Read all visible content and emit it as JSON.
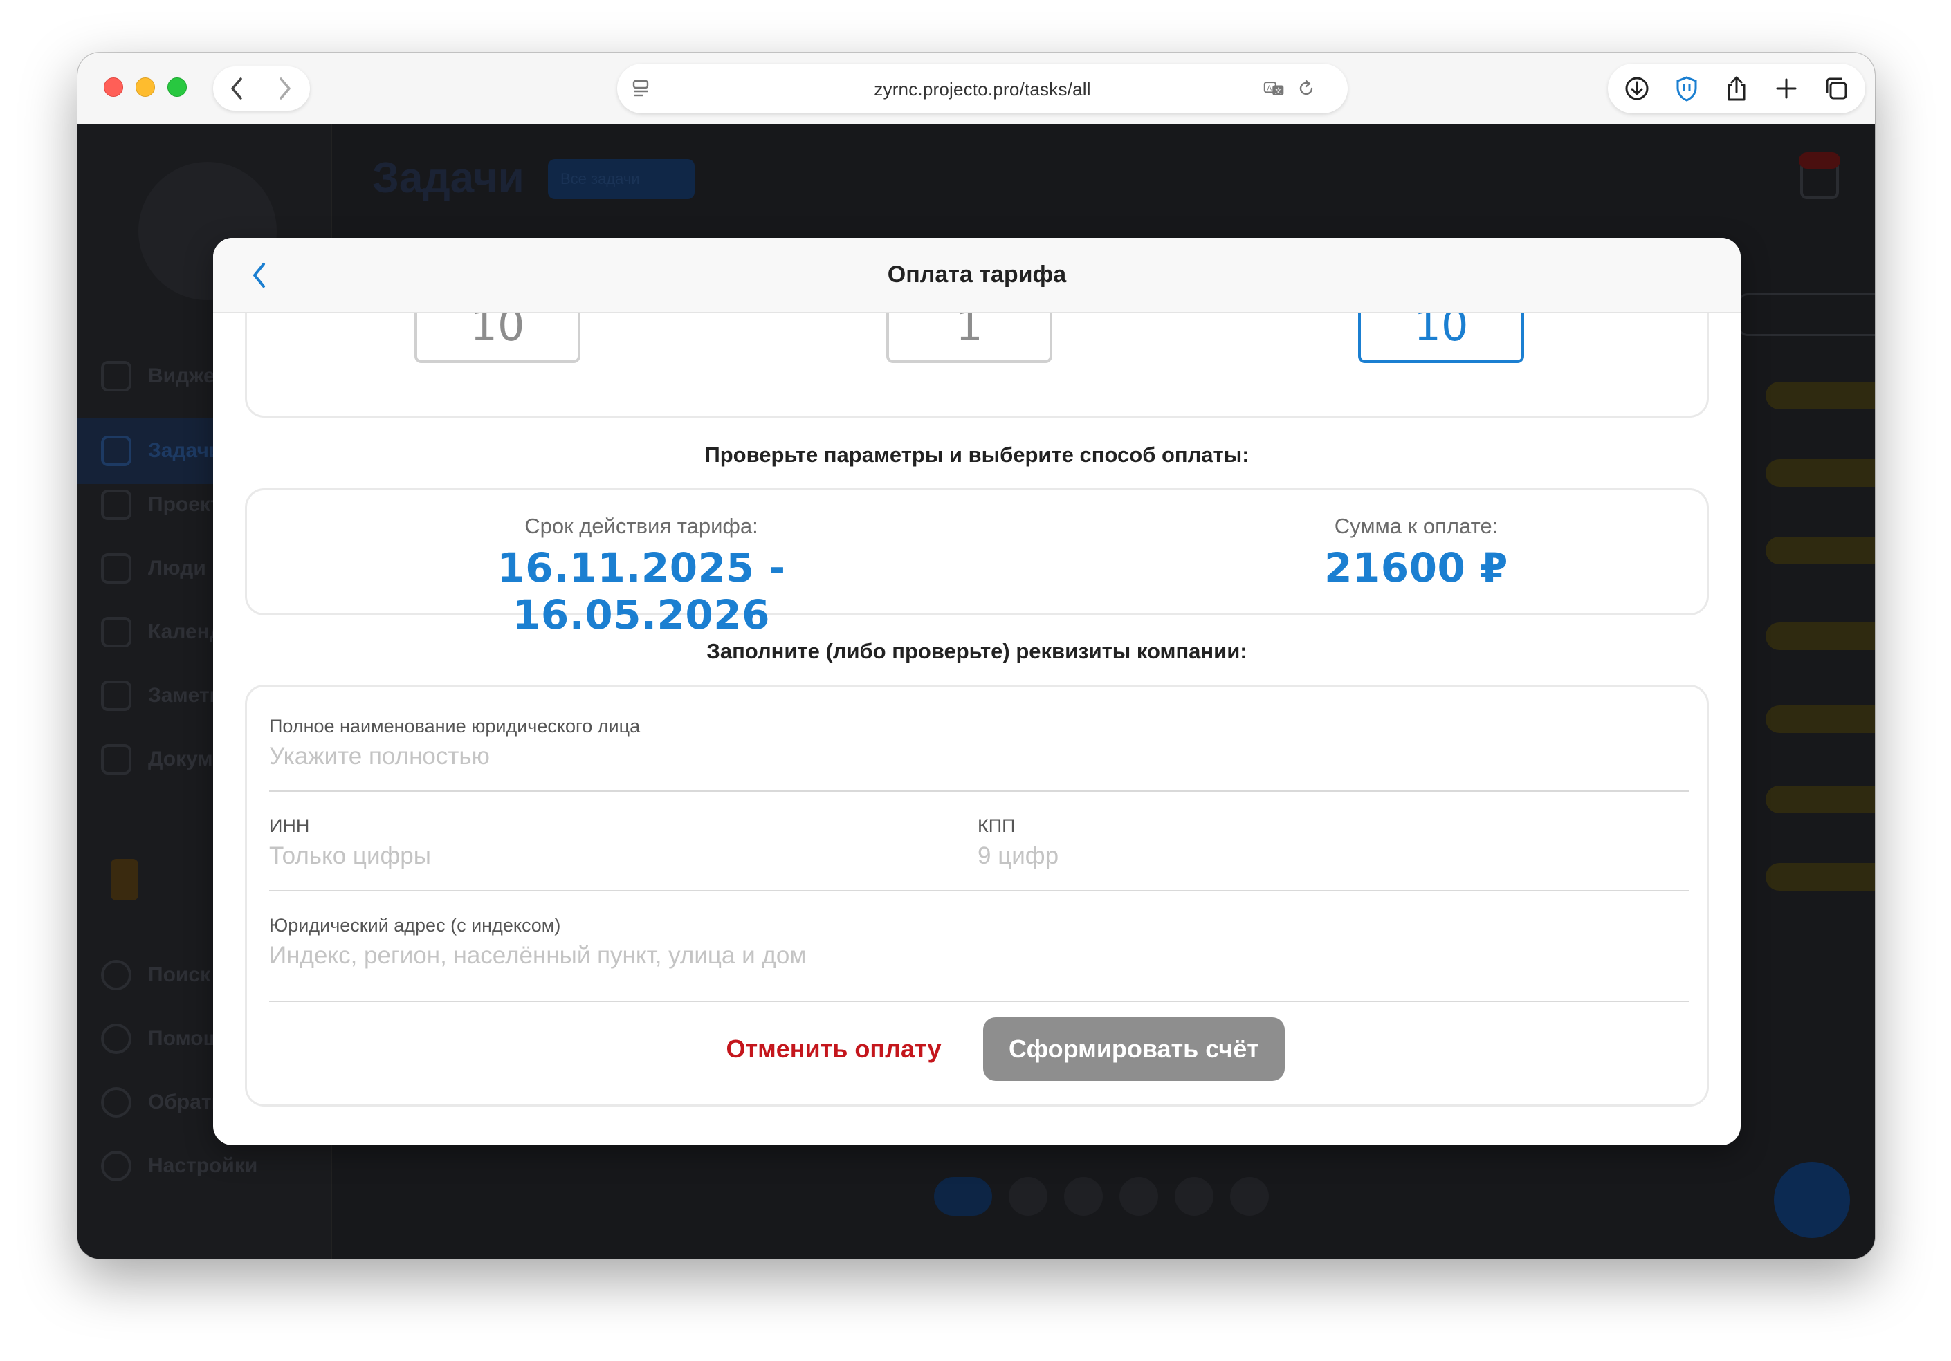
{
  "browser": {
    "url": "zyrnc.projecto.pro/tasks/all"
  },
  "modal": {
    "title": "Оплата тарифа",
    "counters": [
      "10",
      "1",
      "10"
    ],
    "check_label": "Проверьте параметры и выберите способ оплаты:",
    "period_caption": "Срок действия тарифа:",
    "period_value": "16.11.2025 - 16.05.2026",
    "amount_caption": "Сумма к оплате:",
    "amount_value": "21600 ₽",
    "requisites_label": "Заполните (либо проверьте) реквизиты компании:",
    "fields": {
      "company_name": {
        "label": "Полное наименование юридического лица",
        "placeholder": "Укажите полностью",
        "value": ""
      },
      "inn": {
        "label": "ИНН",
        "placeholder": "Только цифры",
        "value": ""
      },
      "kpp": {
        "label": "КПП",
        "placeholder": "9 цифр",
        "value": ""
      },
      "address": {
        "label": "Юридический адрес (с индексом)",
        "placeholder": "Индекс, регион, населённый пункт, улица и дом",
        "value": ""
      }
    },
    "cancel_label": "Отменить оплату",
    "submit_label": "Сформировать счёт"
  },
  "background_app": {
    "page_title": "Задачи",
    "filter_label": "Все задачи",
    "sidebar_items": [
      "Виджеты",
      "Задачи",
      "Проекты",
      "Люди",
      "Календарь",
      "Заметки",
      "Документы",
      "Поиск",
      "Помощь",
      "Обратная связь",
      "Настройки"
    ]
  },
  "colors": {
    "accent": "#1b7fd1",
    "danger": "#c4161c",
    "disabled_button": "#8e8e8e"
  }
}
